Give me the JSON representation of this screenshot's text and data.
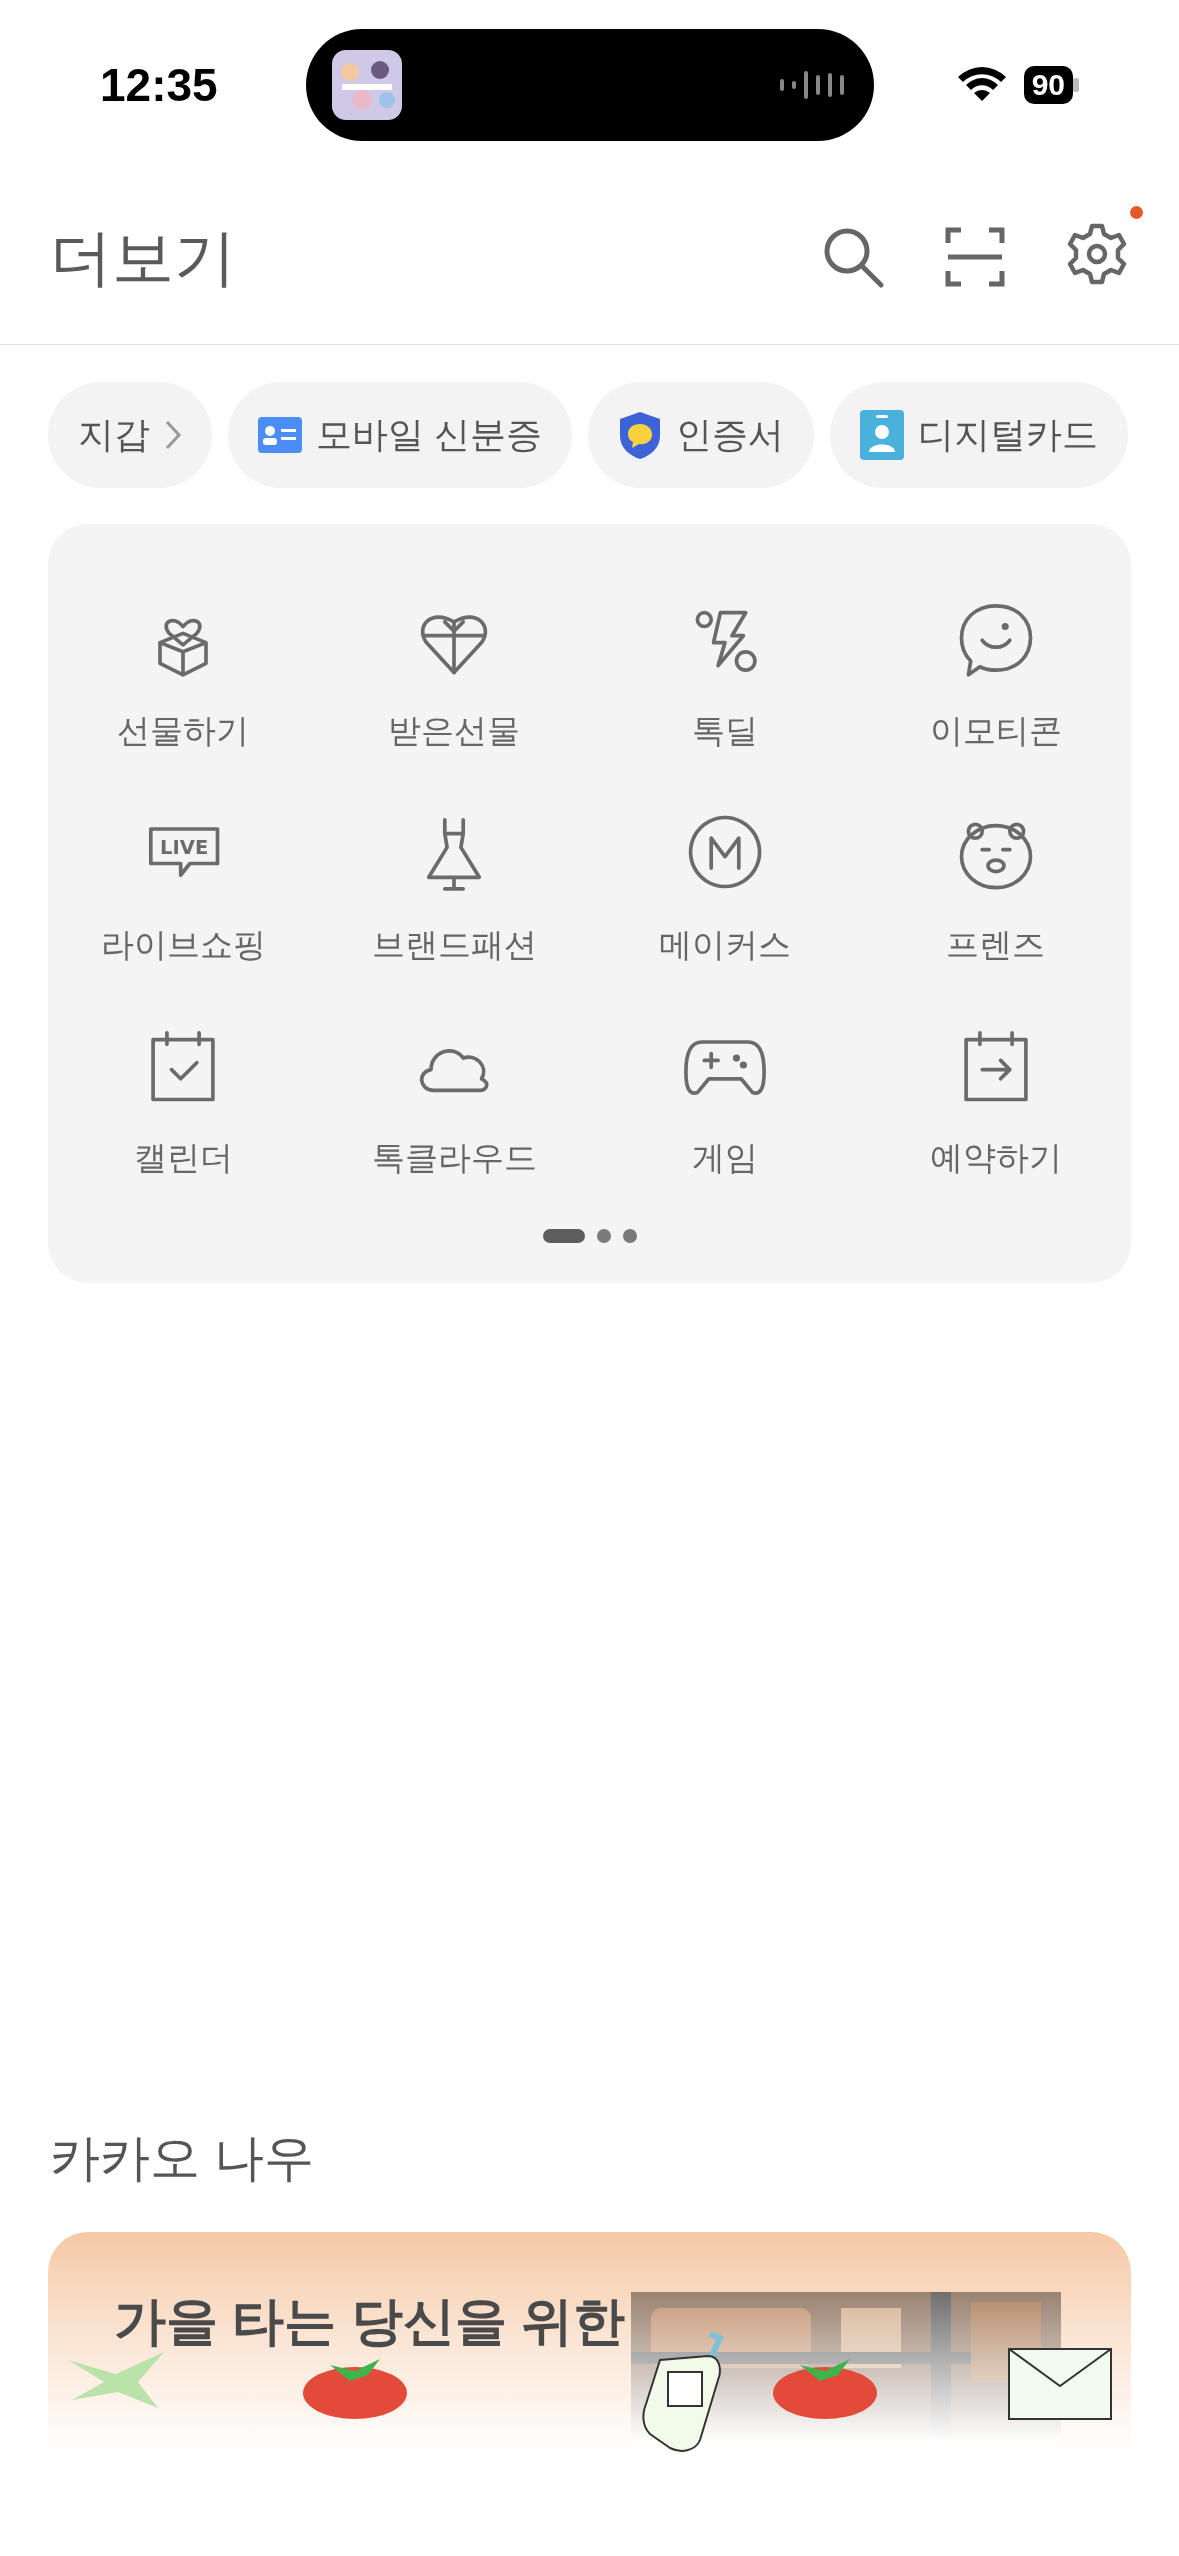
{
  "status_bar": {
    "time": "12:35",
    "battery": "90"
  },
  "header": {
    "title": "더보기",
    "settings_badge": true
  },
  "quick_chips": [
    {
      "label": "지갑",
      "kind": "link"
    },
    {
      "label": "모바일 신분증",
      "kind": "item"
    },
    {
      "label": "인증서",
      "kind": "item"
    },
    {
      "label": "디지털카드",
      "kind": "item"
    }
  ],
  "services": [
    {
      "label": "선물하기"
    },
    {
      "label": "받은선물"
    },
    {
      "label": "톡딜"
    },
    {
      "label": "이모티콘"
    },
    {
      "label": "라이브쇼핑",
      "icon_text": "LIVE"
    },
    {
      "label": "브랜드패션"
    },
    {
      "label": "메이커스"
    },
    {
      "label": "프렌즈"
    },
    {
      "label": "캘린더"
    },
    {
      "label": "톡클라우드"
    },
    {
      "label": "게임"
    },
    {
      "label": "예약하기"
    }
  ],
  "pagination": [
    {
      "selected": true
    },
    {
      "selected": false
    },
    {
      "selected": false
    }
  ],
  "kakao_now": {
    "title": "카카오 나우",
    "banner": {
      "headline": "가을 타는 당신을 위한"
    }
  }
}
